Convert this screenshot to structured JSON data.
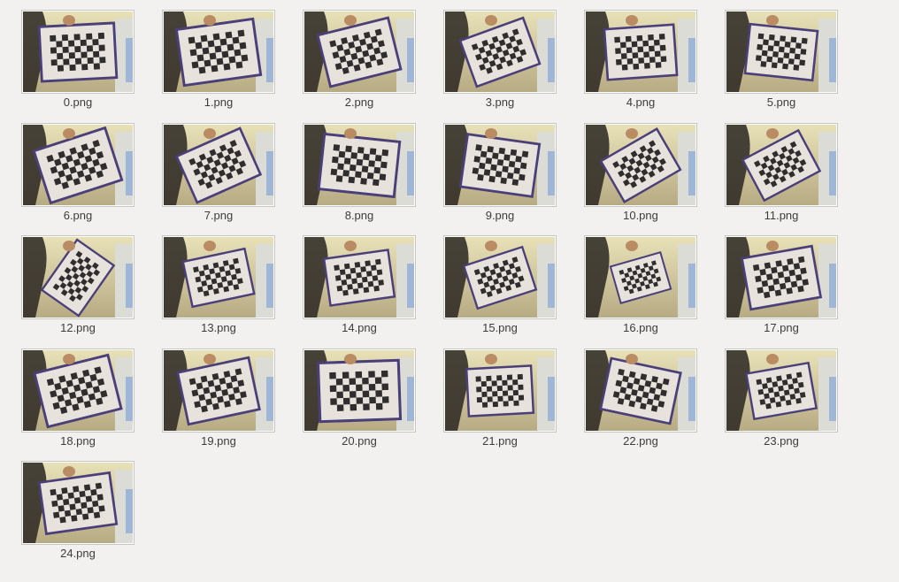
{
  "window": {
    "background": "#f2f1f0"
  },
  "files": [
    {
      "name": "0.png",
      "board": {
        "rot": -3,
        "scale": 0.95,
        "frame": "#4a3f78"
      }
    },
    {
      "name": "1.png",
      "board": {
        "rot": -8,
        "scale": 0.98,
        "frame": "#4a3f78"
      }
    },
    {
      "name": "2.png",
      "board": {
        "rot": -14,
        "scale": 0.92,
        "frame": "#4a3f78"
      }
    },
    {
      "name": "3.png",
      "board": {
        "rot": -20,
        "scale": 0.85,
        "frame": "#4a3f78"
      }
    },
    {
      "name": "4.png",
      "board": {
        "rot": -4,
        "scale": 0.88,
        "frame": "#4a3f78"
      }
    },
    {
      "name": "5.png",
      "board": {
        "rot": 6,
        "scale": 0.86,
        "frame": "#4a3f78"
      }
    },
    {
      "name": "6.png",
      "board": {
        "rot": -18,
        "scale": 0.95,
        "frame": "#4a3f78"
      }
    },
    {
      "name": "7.png",
      "board": {
        "rot": -24,
        "scale": 0.88,
        "frame": "#4a3f78"
      }
    },
    {
      "name": "8.png",
      "board": {
        "rot": 6,
        "scale": 0.96,
        "frame": "#4a3f78"
      }
    },
    {
      "name": "9.png",
      "board": {
        "rot": 8,
        "scale": 0.92,
        "frame": "#4a3f78"
      }
    },
    {
      "name": "10.png",
      "board": {
        "rot": -30,
        "scale": 0.82,
        "frame": "#4a3f78"
      }
    },
    {
      "name": "11.png",
      "board": {
        "rot": -28,
        "scale": 0.8,
        "frame": "#4a3f78"
      }
    },
    {
      "name": "12.png",
      "board": {
        "rot": -55,
        "scale": 0.78,
        "frame": "#4a3f78"
      }
    },
    {
      "name": "13.png",
      "board": {
        "rot": -12,
        "scale": 0.8,
        "frame": "#4a3f78"
      }
    },
    {
      "name": "14.png",
      "board": {
        "rot": -8,
        "scale": 0.82,
        "frame": "#4a3f78"
      }
    },
    {
      "name": "15.png",
      "board": {
        "rot": -18,
        "scale": 0.78,
        "frame": "#4a3f78"
      }
    },
    {
      "name": "16.png",
      "board": {
        "rot": -16,
        "scale": 0.66,
        "frame": "#4a3f78"
      }
    },
    {
      "name": "17.png",
      "board": {
        "rot": -10,
        "scale": 0.9,
        "frame": "#4a3f78"
      }
    },
    {
      "name": "18.png",
      "board": {
        "rot": -14,
        "scale": 0.96,
        "frame": "#4a3f78"
      }
    },
    {
      "name": "19.png",
      "board": {
        "rot": -12,
        "scale": 0.92,
        "frame": "#4a3f78"
      }
    },
    {
      "name": "20.png",
      "board": {
        "rot": -2,
        "scale": 1.02,
        "frame": "#4a3f78"
      }
    },
    {
      "name": "21.png",
      "board": {
        "rot": -3,
        "scale": 0.82,
        "frame": "#4a3f78"
      }
    },
    {
      "name": "22.png",
      "board": {
        "rot": 12,
        "scale": 0.9,
        "frame": "#4a3f78"
      }
    },
    {
      "name": "23.png",
      "board": {
        "rot": -10,
        "scale": 0.8,
        "frame": "#4a3f78"
      }
    },
    {
      "name": "24.png",
      "board": {
        "rot": -8,
        "scale": 0.9,
        "frame": "#4a3f78"
      }
    }
  ],
  "colors": {
    "scene_top": "#e8e1b8",
    "scene_bottom": "#b7ab83",
    "paper": "#e7e3dc",
    "square": "#2f2d2d",
    "person": "#2a2621",
    "hand": "#b98c64",
    "curtain": "#dcdcd7",
    "accent_blue": "#9fb6d6"
  }
}
